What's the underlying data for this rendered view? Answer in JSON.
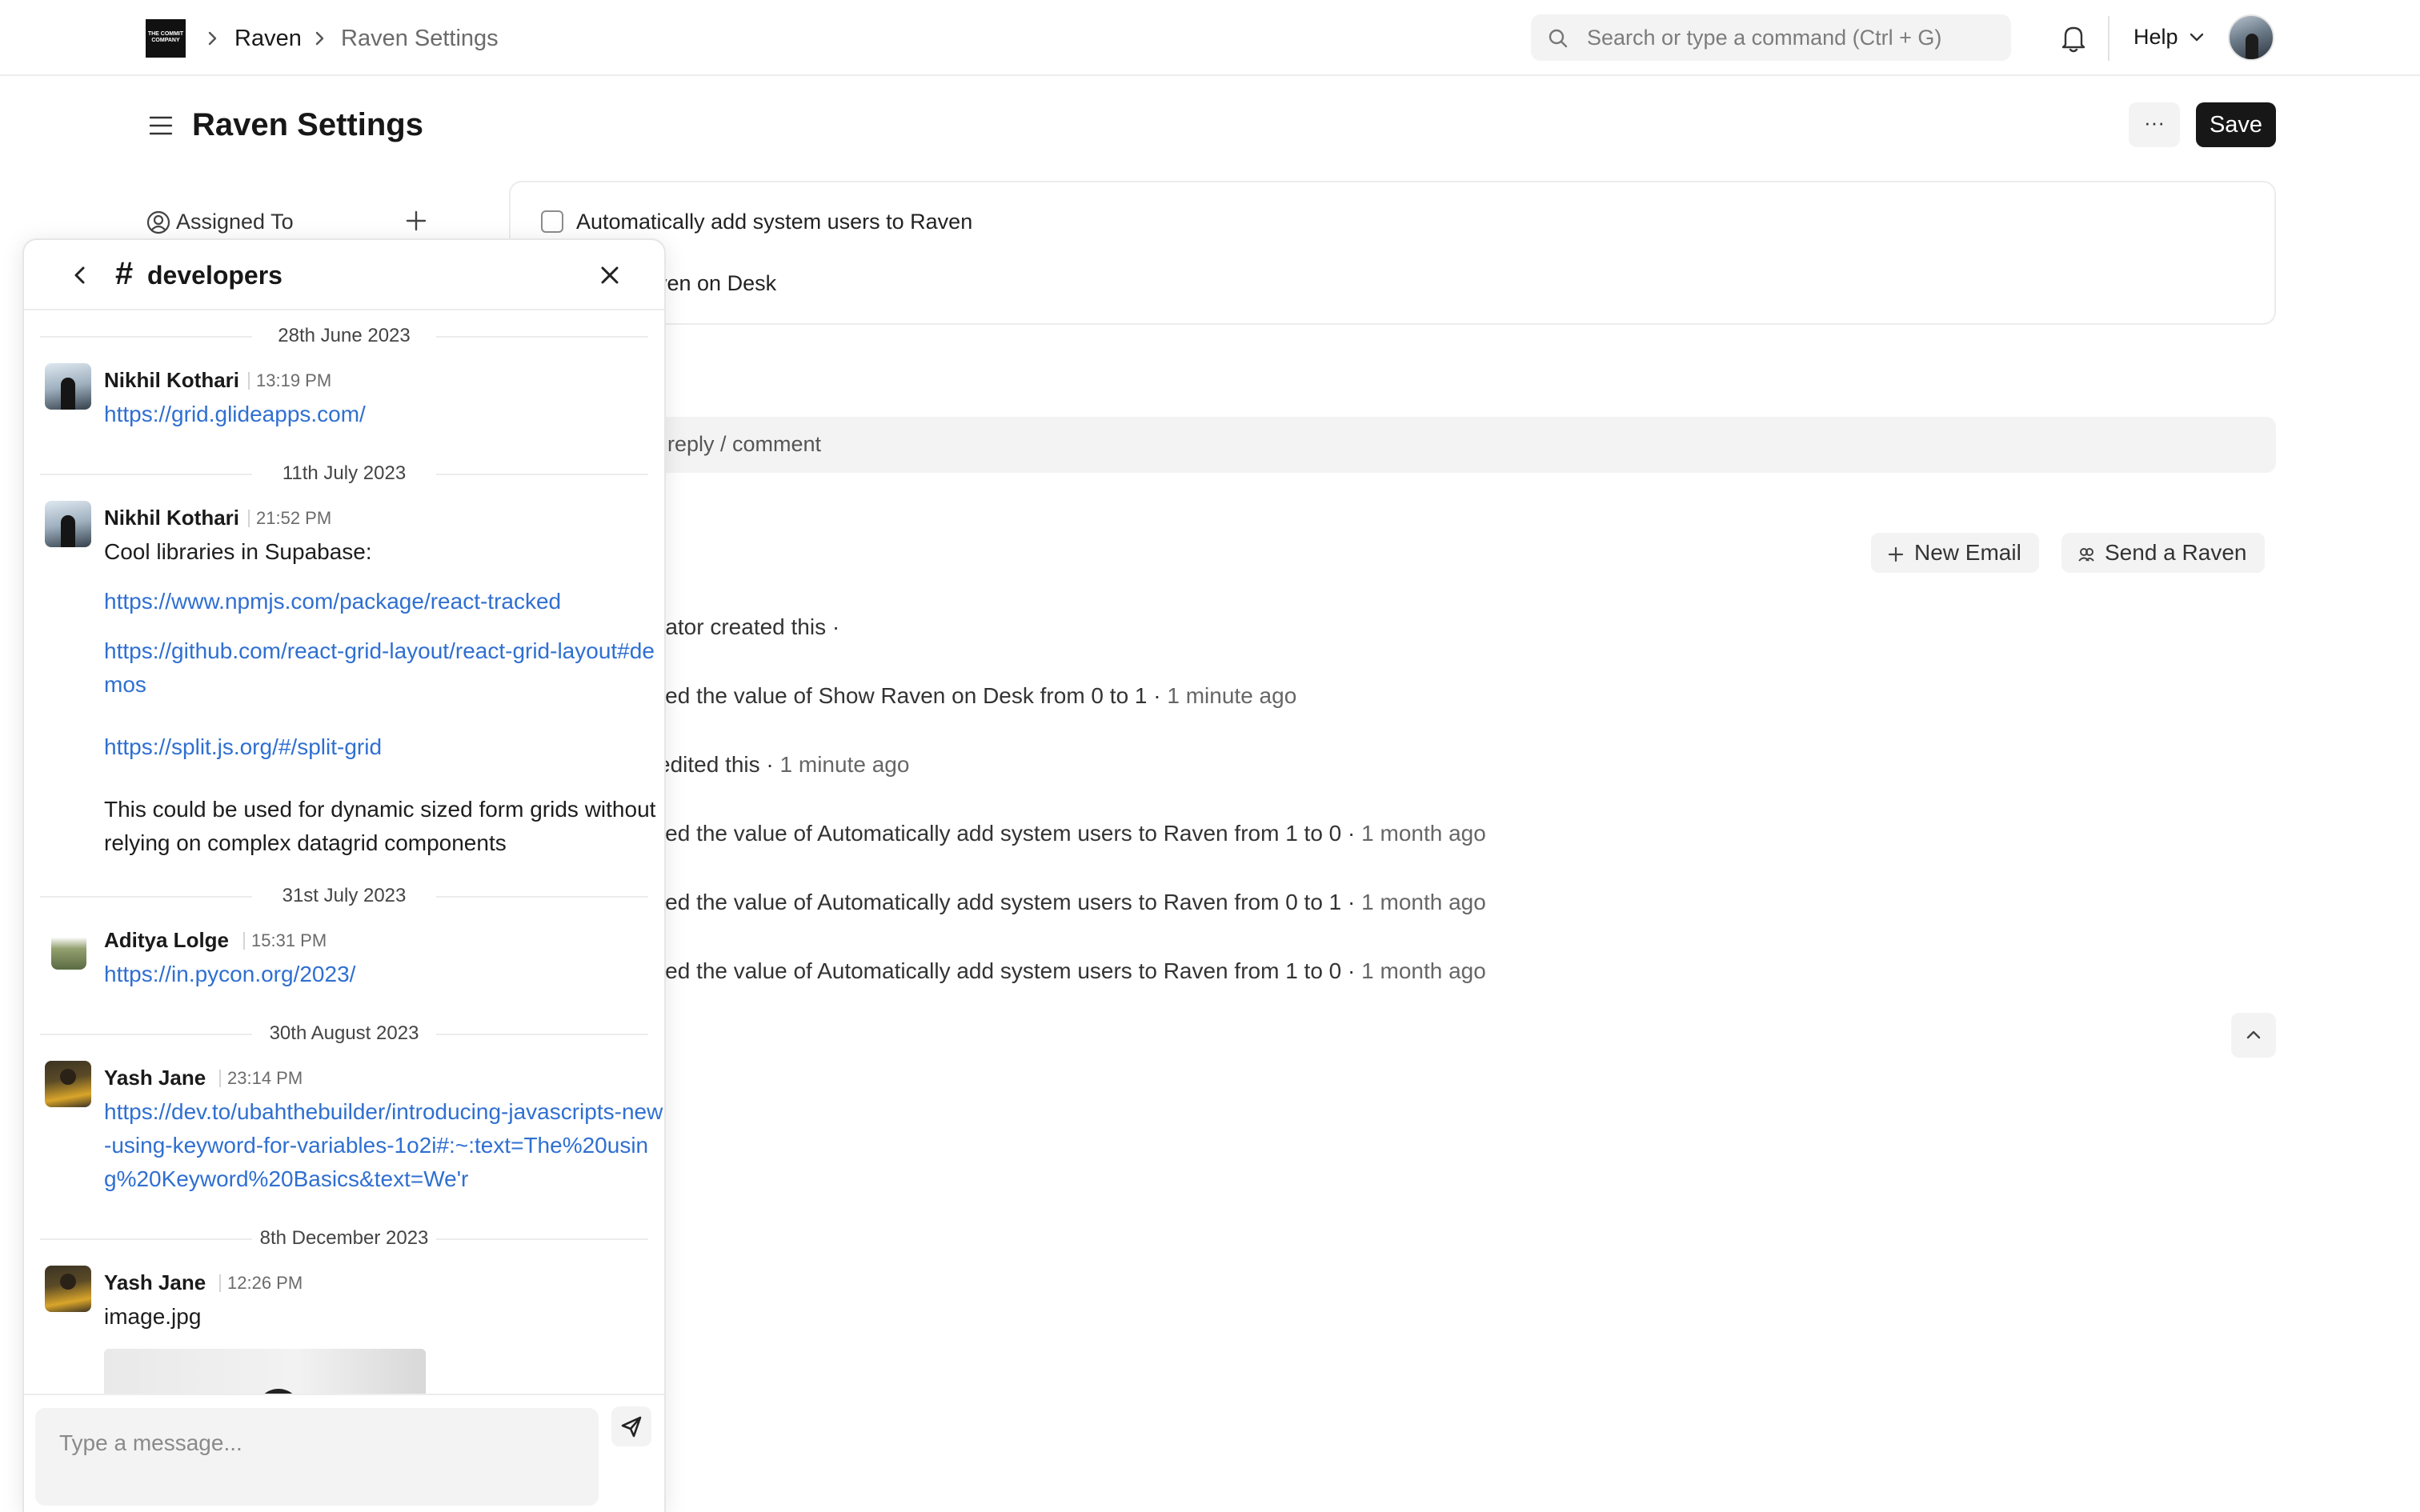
{
  "navbar": {
    "logo_text": "THE COMMIT COMPANY",
    "breadcrumbs": [
      "Raven",
      "Raven Settings"
    ],
    "search_placeholder": "Search or type a command (Ctrl + G)",
    "help_label": "Help"
  },
  "page": {
    "title": "Raven Settings",
    "more_label": "···",
    "save_label": "Save"
  },
  "sidebar": {
    "assigned_label": "Assigned To"
  },
  "settings": {
    "auto_add_label": "Automatically add system users to Raven",
    "show_on_desk_label": "ven on Desk"
  },
  "comment": {
    "placeholder": "reply / comment"
  },
  "actions": {
    "new_email": "New Email",
    "send_raven": "Send a Raven"
  },
  "timeline": [
    {
      "text": "rator created this ·",
      "time": ""
    },
    {
      "text": "nged the value of Show Raven on Desk from 0 to 1 ·",
      "time": "1 minute ago"
    },
    {
      "text": "edited this ·",
      "time": "1 minute ago"
    },
    {
      "text": "nged the value of Automatically add system users to Raven from 1 to 0 ·",
      "time": "1 month ago"
    },
    {
      "text": "nged the value of Automatically add system users to Raven from 0 to 1 ·",
      "time": "1 month ago"
    },
    {
      "text": "nged the value of Automatically add system users to Raven from 1 to 0 ·",
      "time": "1 month ago"
    }
  ],
  "chat": {
    "channel_hash": "#",
    "channel_name": "developers",
    "date_separators": [
      "28th June 2023",
      "11th July 2023",
      "31st July 2023",
      "30th August 2023",
      "8th December 2023"
    ],
    "messages": [
      {
        "author": "Nikhil Kothari",
        "time": "13:19 PM",
        "links": [
          "https://grid.glideapps.com/"
        ]
      },
      {
        "author": "Nikhil Kothari",
        "time": "21:52 PM",
        "text": "Cool libraries in Supabase:",
        "links": [
          "https://www.npmjs.com/package/react-tracked",
          "https://github.com/react-grid-layout/react-grid-layout#demos",
          "https://split.js.org/#/split-grid"
        ],
        "text2": "This could be used for dynamic sized form grids without relying on complex datagrid components"
      },
      {
        "author": "Aditya Lolge",
        "time": "15:31 PM",
        "links": [
          "https://in.pycon.org/2023/"
        ]
      },
      {
        "author": "Yash Jane",
        "time": "23:14 PM",
        "links": [
          "https://dev.to/ubahthebuilder/introducing-javascripts-new-using-keyword-for-variables-1o2i#:~:text=The%20using%20Keyword%20Basics&text=We'r"
        ]
      },
      {
        "author": "Yash Jane",
        "time": "12:26 PM",
        "text": "image.jpg"
      }
    ],
    "composer_placeholder": "Type a message..."
  }
}
